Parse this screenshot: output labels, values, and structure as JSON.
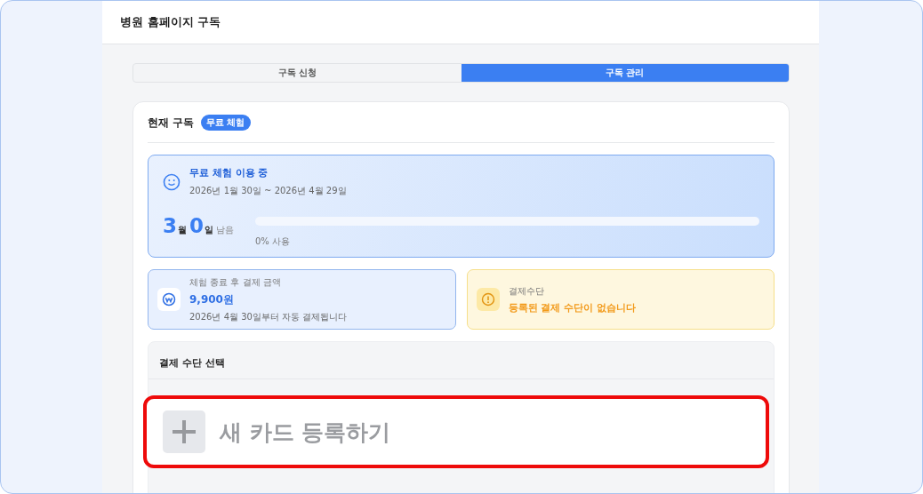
{
  "header": {
    "title": "병원 홈페이지 구독"
  },
  "tabs": [
    {
      "label": "구독 신청",
      "selected": false
    },
    {
      "label": "구독 관리",
      "selected": true
    }
  ],
  "current": {
    "title": "현재 구독",
    "badge": "무료 체험"
  },
  "trial": {
    "title": "무료 체험 이용 중",
    "period": "2026년 1월 30일 ~ 2026년 4월 29일",
    "remaining": [
      {
        "value": "3",
        "unit": "월"
      },
      {
        "value": "0",
        "unit": "일"
      }
    ],
    "remaining_label": "남음",
    "level": 0,
    "usage": "0% 사용"
  },
  "price": {
    "label": "체험 종료 후 결제 금액",
    "amount": "9,900원",
    "note": "2026년 4월 30일부터 자동 결제됩니다"
  },
  "payment_status": {
    "label": "결제수단",
    "message": "등록된 결제 수단이 없습니다"
  },
  "payment_select": {
    "title": "결제 수단 선택",
    "add_card": "새 카드 등록하기"
  }
}
